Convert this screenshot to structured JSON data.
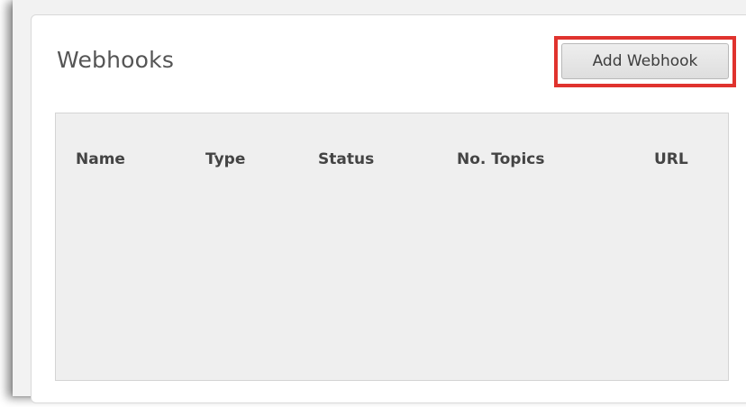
{
  "panel": {
    "title": "Webhooks",
    "add_button_label": "Add Webhook"
  },
  "table": {
    "columns": [
      "Name",
      "Type",
      "Status",
      "No. Topics",
      "URL"
    ],
    "rows": []
  },
  "colors": {
    "highlight": "#e0332e",
    "table_background": "#efefef",
    "button_background": "#e4e4e4",
    "title_text": "#555555"
  }
}
